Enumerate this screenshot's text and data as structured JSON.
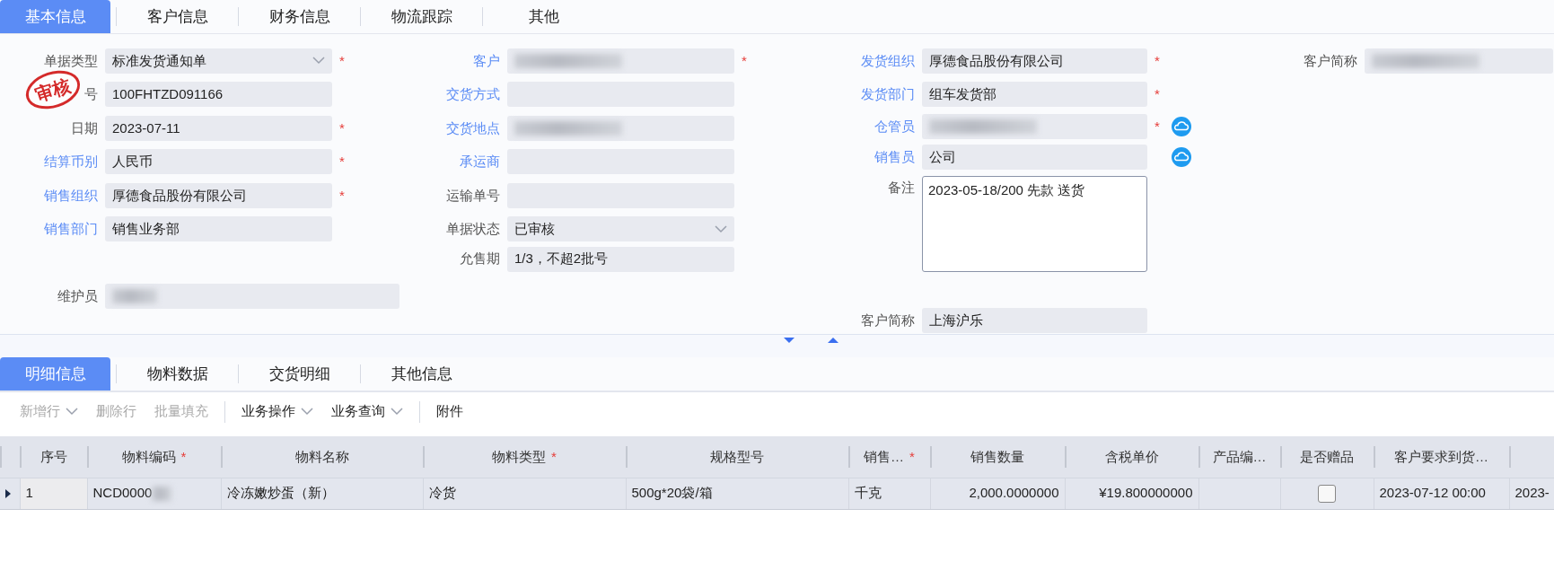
{
  "tabs": [
    {
      "label": "基本信息",
      "selected": true
    },
    {
      "label": "客户信息",
      "selected": false
    },
    {
      "label": "财务信息",
      "selected": false
    },
    {
      "label": "物流跟踪",
      "selected": false
    },
    {
      "label": "其他",
      "selected": false
    }
  ],
  "form_columns": [
    {
      "fields": [
        {
          "label": "单据类型",
          "value": "标准发货通知单",
          "kind": "select",
          "link": false,
          "required_mark": "*"
        },
        {
          "label": "号",
          "value": "100FHTZD091166",
          "kind": "text",
          "link": false,
          "stamp": "审核"
        },
        {
          "label": "日期",
          "value": "2023-07-11",
          "kind": "text",
          "link": false,
          "required_mark": "*"
        },
        {
          "label": "结算币别",
          "value": "人民币",
          "kind": "text",
          "link": true,
          "required_mark": "*"
        },
        {
          "label": "销售组织",
          "value": "厚德食品股份有限公司",
          "kind": "text",
          "link": true,
          "required_mark": "*"
        },
        {
          "label": "销售部门",
          "value": "销售业务部",
          "kind": "text",
          "link": true
        },
        {
          "label": "维护员",
          "kind": "text",
          "link": false,
          "masked": true
        }
      ]
    },
    {
      "fields": [
        {
          "label": "客户",
          "kind": "text",
          "link": true,
          "required_mark": "*",
          "masked": true
        },
        {
          "label": "交货方式",
          "kind": "text",
          "link": true
        },
        {
          "label": "交货地点",
          "kind": "text",
          "link": true,
          "masked": true
        },
        {
          "label": "承运商",
          "kind": "text",
          "link": true
        },
        {
          "label": "运输单号",
          "kind": "text",
          "link": false
        },
        {
          "label": "单据状态",
          "value": "已审核",
          "kind": "select",
          "link": false
        },
        {
          "label": "允售期",
          "value": "1/3，不超2批号",
          "kind": "text",
          "link": false
        }
      ]
    },
    {
      "fields": [
        {
          "label": "发货组织",
          "value": "厚德食品股份有限公司",
          "kind": "text",
          "link": true,
          "required_mark": "*"
        },
        {
          "label": "发货部门",
          "value": "组车发货部",
          "kind": "text",
          "link": true,
          "required_mark": "*"
        },
        {
          "label": "仓管员",
          "kind": "text",
          "link": true,
          "required_mark": "*",
          "masked": true,
          "lookup": true
        },
        {
          "label": "销售员",
          "value": "公司",
          "kind": "text",
          "link": true,
          "lookup": true
        },
        {
          "label": "备注",
          "value": "2023-05-18/200 先款 送货",
          "kind": "textarea",
          "link": false
        },
        {
          "label": "客户简称",
          "value": "上海沪乐",
          "kind": "text",
          "link": false
        }
      ]
    },
    {
      "fields": [
        {
          "label": "客户简称",
          "kind": "text",
          "link": false,
          "masked": true
        }
      ]
    }
  ],
  "detail_tabs": [
    {
      "label": "明细信息",
      "selected": true
    },
    {
      "label": "物料数据",
      "selected": false
    },
    {
      "label": "交货明细",
      "selected": false
    },
    {
      "label": "其他信息",
      "selected": false
    }
  ],
  "toolbar": [
    {
      "label": "新增行",
      "kind": "dropdown",
      "disabled": true
    },
    {
      "label": "删除行",
      "kind": "button",
      "disabled": true
    },
    {
      "label": "批量填充",
      "kind": "button",
      "disabled": true
    },
    {
      "kind": "separator"
    },
    {
      "label": "业务操作",
      "kind": "dropdown",
      "disabled": false
    },
    {
      "label": "业务查询",
      "kind": "dropdown",
      "disabled": false
    },
    {
      "kind": "separator"
    },
    {
      "label": "附件",
      "kind": "button",
      "disabled": false
    }
  ],
  "table": {
    "columns": [
      {
        "label": "序号"
      },
      {
        "label": "物料编码",
        "required_mark": "*"
      },
      {
        "label": "物料名称"
      },
      {
        "label": "物料类型",
        "required_mark": "*"
      },
      {
        "label": "规格型号"
      },
      {
        "label": "销售…",
        "required_mark": "*"
      },
      {
        "label": "销售数量"
      },
      {
        "label": "含税单价"
      },
      {
        "label": "产品编…"
      },
      {
        "label": "是否赠品"
      },
      {
        "label": "客户要求到货…"
      }
    ],
    "rows": [
      {
        "current": true,
        "cells": [
          {
            "kind": "text",
            "text": "1"
          },
          {
            "kind": "text",
            "text": "NCD0000",
            "masked": true
          },
          {
            "kind": "text",
            "text": "冷冻嫩炒蛋（新）"
          },
          {
            "kind": "text",
            "text": "冷货"
          },
          {
            "kind": "text",
            "text": "500g*20袋/箱"
          },
          {
            "kind": "text",
            "text": "千克"
          },
          {
            "kind": "text",
            "text": "2,000.0000000"
          },
          {
            "kind": "text",
            "text": "¥19.800000000"
          },
          {
            "kind": "blank"
          },
          {
            "kind": "checkbox",
            "checked": false
          },
          {
            "kind": "text",
            "text": "2023-07-12 00:00"
          },
          {
            "kind": "text",
            "text": "2023-"
          }
        ]
      }
    ]
  }
}
